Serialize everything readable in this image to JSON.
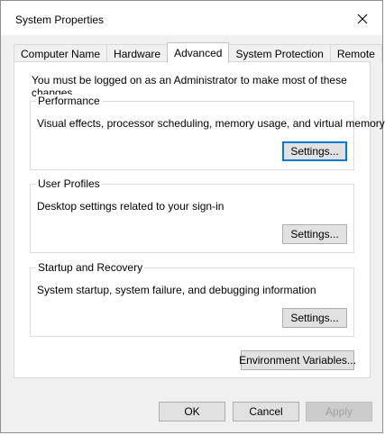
{
  "window": {
    "title": "System Properties",
    "close_icon": "close-icon"
  },
  "tabs": [
    {
      "label": "Computer Name"
    },
    {
      "label": "Hardware"
    },
    {
      "label": "Advanced",
      "active": true
    },
    {
      "label": "System Protection"
    },
    {
      "label": "Remote"
    }
  ],
  "notice": "You must be logged on as an Administrator to make most of these changes.",
  "performance": {
    "title": "Performance",
    "description": "Visual effects, processor scheduling, memory usage, and virtual memory",
    "button": "Settings..."
  },
  "user_profiles": {
    "title": "User Profiles",
    "description": "Desktop settings related to your sign-in",
    "button": "Settings..."
  },
  "startup_recovery": {
    "title": "Startup and Recovery",
    "description": "System startup, system failure, and debugging information",
    "button": "Settings..."
  },
  "env_button": "Environment Variables...",
  "footer": {
    "ok": "OK",
    "cancel": "Cancel",
    "apply": "Apply"
  }
}
